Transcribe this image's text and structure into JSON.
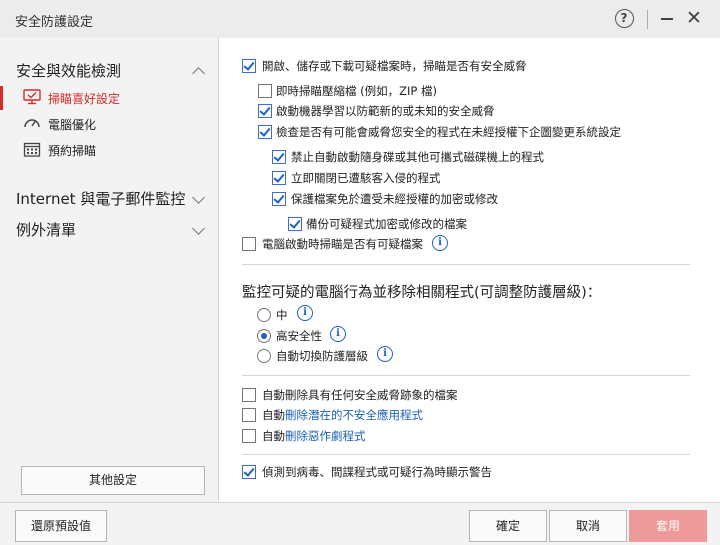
{
  "window": {
    "title": "安全防護設定",
    "help_glyph": "?",
    "close_glyph": "✕"
  },
  "sidebar": {
    "section1_title": "安全與效能檢測",
    "items": [
      {
        "label": "掃瞄喜好設定",
        "icon": "monitor-scan-icon",
        "active": true
      },
      {
        "label": "電腦優化",
        "icon": "gauge-icon",
        "active": false
      },
      {
        "label": "預約掃瞄",
        "icon": "calendar-icon",
        "active": false
      }
    ],
    "section2_title": "Internet 與電子郵件監控",
    "section3_title": "例外清單",
    "more_settings": "其他設定"
  },
  "settings": {
    "opt1": "開啟、儲存或下載可疑檔案時，掃瞄是否有安全威脅",
    "opt2": "即時掃瞄壓縮檔 (例如，ZIP 檔)",
    "opt3": "啟動機器學習以防範新的或未知的安全威脅",
    "opt4": "檢查是否有可能會威脅您安全的程式在未經授權下企圖變更系統設定",
    "opt5": "禁止自動啟動隨身碟或其他可攜式磁碟機上的程式",
    "opt6": "立即關閉已遭駭客入侵的程式",
    "opt7": "保護檔案免於遭受未經授權的加密或修改",
    "opt8": "備份可疑程式加密或修改的檔案",
    "opt9": "電腦啟動時掃瞄是否有可疑檔案",
    "monitor_heading": "監控可疑的電腦行為並移除相關程式(可調整防護層級)：",
    "radio_medium": "中",
    "radio_high": "高安全性",
    "radio_auto": "自動切換防護層級",
    "del_threats": "自動刪除具有任何安全威脅跡象的檔案",
    "del_pua_prefix": "自動",
    "del_pua_link": "刪除潛在的不安全應用程式",
    "del_joke_prefix": "自動",
    "del_joke_link": "刪除惡作劇程式",
    "warn": "偵測到病毒、間諜程式或可疑行為時顯示警告",
    "info_glyph": "i"
  },
  "states": {
    "opt1": true,
    "opt2": false,
    "opt3": true,
    "opt4": true,
    "opt5": true,
    "opt6": true,
    "opt7": true,
    "opt8": true,
    "opt9": false,
    "protection_level": "high",
    "del_threats": false,
    "del_pua": false,
    "del_joke": false,
    "warn": true
  },
  "footer": {
    "restore": "還原預設值",
    "ok": "確定",
    "cancel": "取消",
    "apply": "套用"
  },
  "colors": {
    "accent_red": "#d72b2b",
    "link_blue": "#1a5fb4",
    "apply_disabled": "#ef9a9a"
  }
}
